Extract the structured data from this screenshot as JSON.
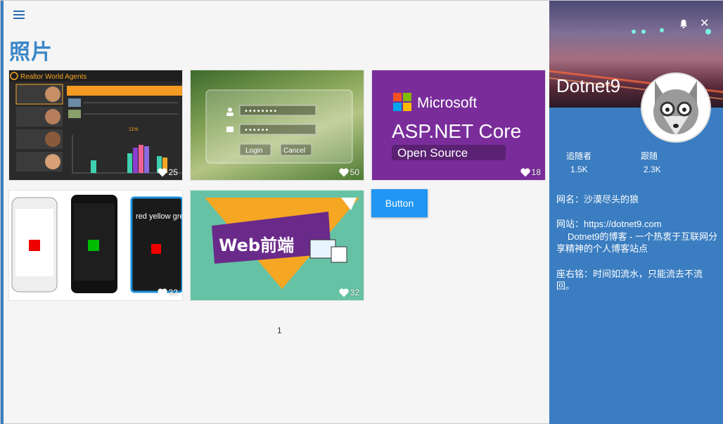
{
  "page": {
    "title": "照片"
  },
  "photos": [
    {
      "likes": "25"
    },
    {
      "likes": "50"
    },
    {
      "likes": "18"
    },
    {
      "likes": "32"
    },
    {
      "likes": "32"
    }
  ],
  "tile_text": {
    "realtor_title": "Realtor World Agents",
    "realtor_chart_label": "11%",
    "login_button": "Login",
    "cancel_button": "Cancel",
    "password_mask": "••••••••",
    "password_mask2": "••••••",
    "ms_brand": "Microsoft",
    "ms_product": "ASP.NET Core",
    "ms_tag": "Open Source",
    "web_title": "Web前端",
    "phone_text": "red yellow gre"
  },
  "button": {
    "label": "Button"
  },
  "pager": {
    "page": "1"
  },
  "profile": {
    "name": "Dotnet9",
    "followers_label": "追随者",
    "followers_value": "1.5K",
    "following_label": "跟随",
    "following_value": "2.3K",
    "nickname": "网名：沙漠尽头的狼",
    "website": "网站：https://dotnet9.com",
    "website_desc": "Dotnet9的博客 - 一个热衷于互联网分享精神的个人博客站点",
    "motto": "座右铭：时间如流水，只能流去不流回。"
  },
  "colors": {
    "accent": "#3a7dc1",
    "button": "#2196f3",
    "title": "#3a87c8"
  }
}
